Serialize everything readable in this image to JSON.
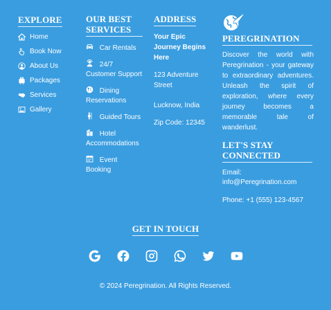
{
  "explore": {
    "heading": "EXPLORE",
    "items": [
      {
        "label": "Home",
        "icon": "home-icon"
      },
      {
        "label": "Book Now",
        "icon": "hand-pointer-icon"
      },
      {
        "label": "About Us",
        "icon": "user-circle-icon"
      },
      {
        "label": "Packages",
        "icon": "luggage-icon"
      },
      {
        "label": "Services",
        "icon": "handshake-icon"
      },
      {
        "label": "Gallery",
        "icon": "image-icon"
      }
    ]
  },
  "services": {
    "heading": "OUR BEST SERVICES",
    "items": [
      {
        "label": "Car Rentals",
        "icon": "car-icon"
      },
      {
        "label": "24/7 Customer Support",
        "icon": "support-agent-icon"
      },
      {
        "label": "Dining Reservations",
        "icon": "dining-icon"
      },
      {
        "label": "Guided Tours",
        "icon": "tour-guide-icon"
      },
      {
        "label": "Hotel Accommodations",
        "icon": "hotel-icon"
      },
      {
        "label": "Event Booking",
        "icon": "calendar-icon"
      }
    ]
  },
  "address": {
    "heading": "ADDRESS",
    "tagline": "Your Epic Journey Begins Here",
    "street": "123 Adventure Street",
    "city": "Lucknow, India",
    "zip": "Zip Code: 12345"
  },
  "brand": {
    "logo_icon": "globe-plane-icon",
    "name": "PEREGRINATION",
    "description": "Discover the world with Peregrination - your gateway to extraordinary adventures. Unleash the spirit of exploration, where every journey becomes a memorable tale of wanderlust."
  },
  "connected": {
    "heading": "LET'S STAY CONNECTED",
    "email": "Email: info@Peregrination.com",
    "phone": "Phone: +1 (555) 123-4567"
  },
  "touch": {
    "heading": "GET IN TOUCH",
    "social": [
      "google-icon",
      "facebook-icon",
      "instagram-icon",
      "whatsapp-icon",
      "twitter-icon",
      "youtube-icon"
    ]
  },
  "footer": {
    "copyright": "© 2024 Peregrination. All Rights Reserved."
  },
  "colors": {
    "background": "#3a9de0",
    "text": "#ffffff"
  }
}
